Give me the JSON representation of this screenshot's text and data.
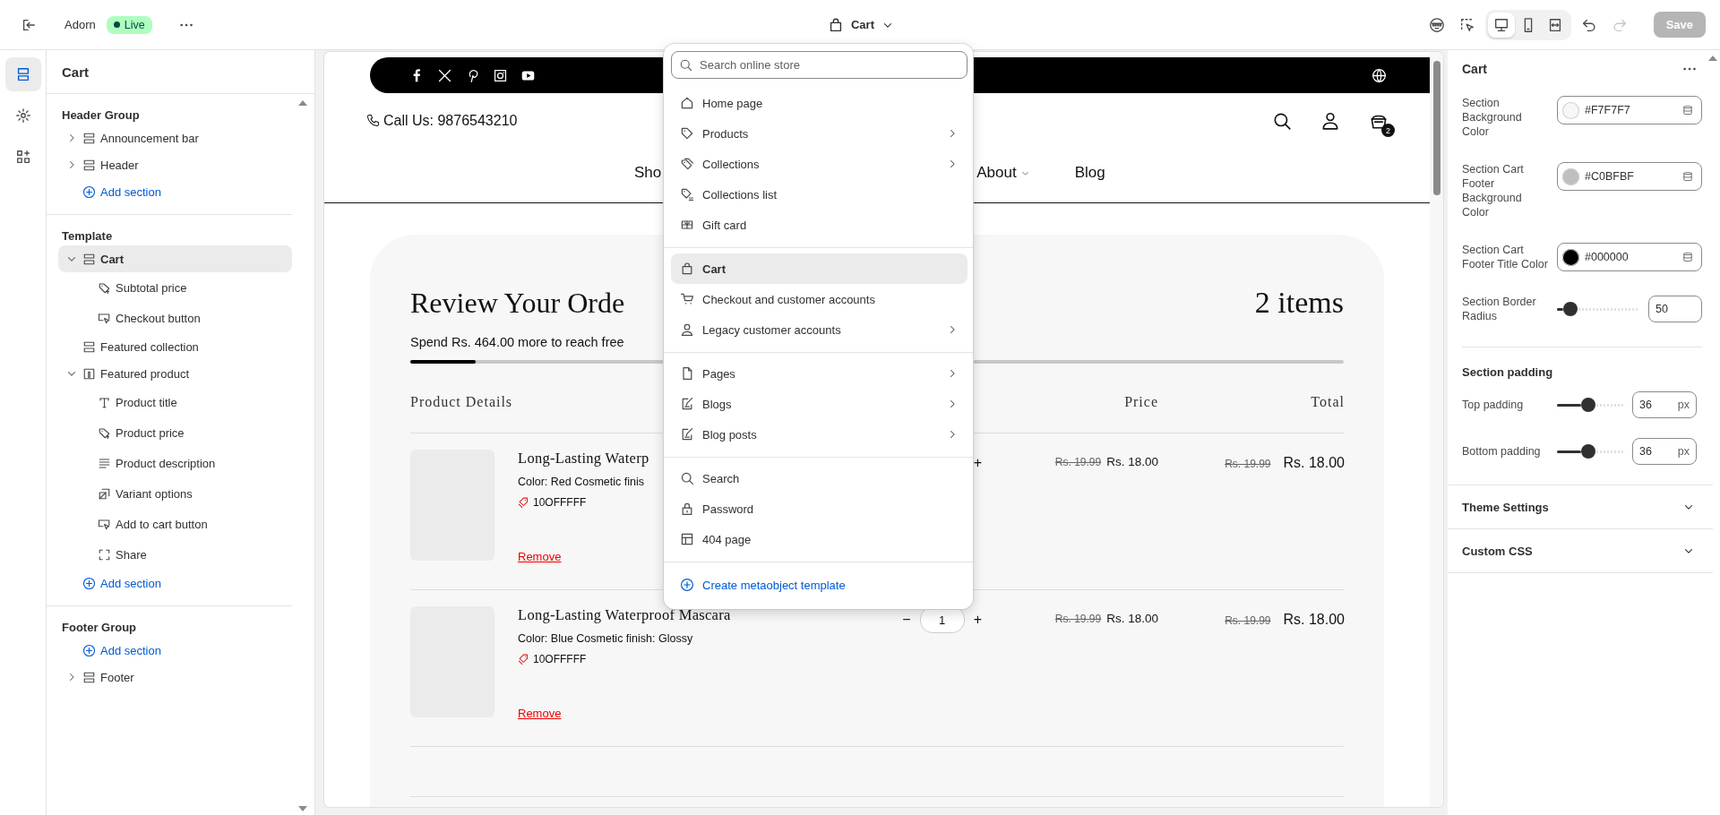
{
  "topbar": {
    "store_name": "Adorn",
    "status": "Live",
    "page_picker": "Cart",
    "view_modes": [
      {
        "kind": "desktop",
        "selected": true
      },
      {
        "kind": "mobile",
        "selected": false
      },
      {
        "kind": "fullwidth",
        "selected": false
      }
    ],
    "redo_disabled": true,
    "save": "Save",
    "save_disabled": true
  },
  "rail": [
    {
      "kind": "sections",
      "selected": true
    },
    {
      "kind": "settings",
      "selected": false
    },
    {
      "kind": "apps",
      "selected": false
    }
  ],
  "sidebar": {
    "title": "Cart",
    "groups": [
      {
        "title": "Header Group",
        "items": [
          {
            "label": "Announcement bar",
            "kind": "section",
            "expanded": false,
            "selected": false
          },
          {
            "label": "Header",
            "kind": "section",
            "expanded": false,
            "selected": false
          },
          {
            "label": "Add section",
            "kind": "add",
            "selected": false
          }
        ]
      },
      {
        "title": "Template",
        "items": [
          {
            "label": "Cart",
            "kind": "section",
            "expanded": true,
            "selected": true,
            "children": [
              {
                "label": "Subtotal price",
                "kind": "price",
                "selected": false
              },
              {
                "label": "Checkout button",
                "kind": "button",
                "selected": false
              }
            ]
          },
          {
            "label": "Featured collection",
            "kind": "section",
            "selected": false
          },
          {
            "label": "Featured product",
            "kind": "product",
            "expanded": true,
            "selected": false,
            "children": [
              {
                "label": "Product title",
                "kind": "title",
                "selected": false
              },
              {
                "label": "Product price",
                "kind": "price",
                "selected": false
              },
              {
                "label": "Product description",
                "kind": "text",
                "selected": false
              },
              {
                "label": "Variant options",
                "kind": "variant",
                "selected": false
              },
              {
                "label": "Add to cart button",
                "kind": "button",
                "selected": false
              },
              {
                "label": "Share",
                "kind": "share",
                "selected": false
              }
            ]
          },
          {
            "label": "Add section",
            "kind": "add",
            "selected": false
          }
        ]
      },
      {
        "title": "Footer Group",
        "items": [
          {
            "label": "Add section",
            "kind": "add",
            "selected": false
          },
          {
            "label": "Footer",
            "kind": "section",
            "expanded": false,
            "selected": false
          }
        ]
      }
    ]
  },
  "preview": {
    "socials": [
      {
        "kind": "facebook"
      },
      {
        "kind": "x"
      },
      {
        "kind": "pinterest"
      },
      {
        "kind": "instagram"
      },
      {
        "kind": "youtube"
      }
    ],
    "phone": "Call Us: 9876543210",
    "cart_count": "2",
    "nav": [
      {
        "label": "Sho",
        "dropdown": false
      },
      {
        "label": "About",
        "dropdown": true
      },
      {
        "label": "Blog",
        "dropdown": false
      }
    ],
    "cart": {
      "title": "Review Your Orde",
      "count": "2 items",
      "spend": "Spend Rs. 464.00 more to reach free",
      "level": 0.07,
      "columns": [
        "Product Details",
        "Price",
        "Total"
      ],
      "items": [
        {
          "title": "Long-Lasting Waterp",
          "variant": "Color: Red Cosmetic finis",
          "coupon": "10OFFFFF",
          "remove": "Remove",
          "stepper": {
            "plus": "+"
          },
          "price_old": "Rs. 19.99",
          "price": "Rs. 18.00",
          "total_old": "Rs. 19.99",
          "total": "Rs. 18.00"
        },
        {
          "title": "Long-Lasting Waterproof Mascara",
          "variant": "Color: Blue Cosmetic finish: Glossy",
          "coupon": "10OFFFFF",
          "remove": "Remove",
          "stepper": {
            "minus": "−",
            "value": "1",
            "plus": "+"
          },
          "price_old": "Rs. 19.99",
          "price": "Rs. 18.00",
          "total_old": "Rs. 19.99",
          "total": "Rs. 18.00"
        }
      ]
    }
  },
  "dropdown": {
    "search_placeholder": "Search online store",
    "groups": [
      [
        {
          "label": "Home page",
          "kind": "home",
          "submenu": false,
          "selected": false
        },
        {
          "label": "Products",
          "kind": "tag",
          "submenu": true,
          "selected": false
        },
        {
          "label": "Collections",
          "kind": "tags",
          "submenu": true,
          "selected": false
        },
        {
          "label": "Collections list",
          "kind": "taglist",
          "submenu": false,
          "selected": false
        },
        {
          "label": "Gift card",
          "kind": "gift",
          "submenu": false,
          "selected": false
        }
      ],
      [
        {
          "label": "Cart",
          "kind": "bag",
          "submenu": false,
          "selected": true
        },
        {
          "label": "Checkout and customer accounts",
          "kind": "cart",
          "submenu": false,
          "selected": false
        },
        {
          "label": "Legacy customer accounts",
          "kind": "person",
          "submenu": true,
          "selected": false
        }
      ],
      [
        {
          "label": "Pages",
          "kind": "page",
          "submenu": true,
          "selected": false
        },
        {
          "label": "Blogs",
          "kind": "blog",
          "submenu": true,
          "selected": false
        },
        {
          "label": "Blog posts",
          "kind": "blog",
          "submenu": true,
          "selected": false
        }
      ],
      [
        {
          "label": "Search",
          "kind": "search",
          "submenu": false,
          "selected": false
        },
        {
          "label": "Password",
          "kind": "lock",
          "submenu": false,
          "selected": false
        },
        {
          "label": "404 page",
          "kind": "layout",
          "submenu": false,
          "selected": false
        }
      ]
    ],
    "create_label": "Create metaobject template"
  },
  "settings": {
    "title": "Cart",
    "colors": [
      {
        "label": "Section Background Color",
        "value": "#F7F7F7"
      },
      {
        "label": "Section Cart Footer Background Color",
        "value": "#C0BFBF"
      },
      {
        "label": "Section Cart Footer Title Color",
        "value": "#000000"
      }
    ],
    "radius": {
      "label": "Section Border Radius",
      "level": 0.08,
      "value": "50"
    },
    "padding": {
      "title": "Section padding",
      "sliders": [
        {
          "label": "Top padding",
          "level": 0.37,
          "value": "36",
          "unit": "px"
        },
        {
          "label": "Bottom padding",
          "level": 0.37,
          "value": "36",
          "unit": "px"
        }
      ]
    },
    "collapsibles": [
      {
        "label": "Theme Settings",
        "expanded": false
      },
      {
        "label": "Custom CSS",
        "expanded": false
      }
    ]
  }
}
